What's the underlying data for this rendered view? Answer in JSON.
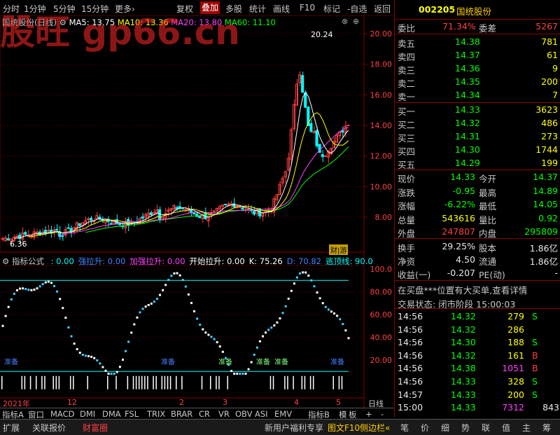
{
  "toolbar": {
    "items": [
      "分时",
      "1分钟",
      "5分钟",
      "15分钟",
      "更多›",
      "复权",
      "叠加",
      "多股",
      "统计",
      "画线",
      "F10",
      "标记",
      "-自选",
      "返回"
    ],
    "active_index": 6
  },
  "chart_header": {
    "stock_label": "国统股份(日线)",
    "ma5": "MA5: 13.75",
    "ma10": "MA10: 13.36",
    "ma20": "MA20: 13.80",
    "ma60": "MA60: 11.10",
    "peak_label": "20.24",
    "low_label": "6.36",
    "badge": "财|游"
  },
  "watermark": "股旺 gp66.cn",
  "price_axis": [
    "20.00",
    "18.00",
    "16.00",
    "14.00",
    "12.00",
    "10.00",
    "8.00"
  ],
  "indicator_header": {
    "name": "指标公式",
    "items": [
      {
        "text": ": 0.00",
        "color": "#00ffff"
      },
      {
        "text": "强拉升: 0.00",
        "color": "#4080ff"
      },
      {
        "text": "加强拉升: 0.00",
        "color": "#ff40ff"
      },
      {
        "text": "开始拉升: 0.00",
        "color": "#ffffff"
      },
      {
        "text": "K: 75.26",
        "color": "#ffffff"
      },
      {
        "text": "D: 70.82",
        "color": "#4080ff"
      },
      {
        "text": "逃顶线: 90.0",
        "color": "#00ffff"
      }
    ]
  },
  "indicator_axis": [
    "100.0",
    "80.00",
    "60.00",
    "40.00",
    "20.00"
  ],
  "indicator_labels": [
    "准备",
    "准备",
    "准备",
    "准备",
    "准备",
    "准备"
  ],
  "time_axis": [
    "2021年",
    "12",
    "2",
    "3",
    "4",
    "5"
  ],
  "time_axis_right": "日线",
  "tabs": [
    "指标A",
    "窗口",
    "MACD",
    "DMI",
    "DMA",
    "FSL",
    "TRIX",
    "BRAR",
    "CR",
    "VR",
    "OBV",
    "ASI",
    "EMV",
    "指标B",
    "模",
    "板",
    "+",
    "-"
  ],
  "status": {
    "left": [
      "扩展",
      "关联报价",
      "财富圈"
    ],
    "right": [
      "新用户福利专享",
      "图文F10",
      "侧边栏«",
      "笔",
      "价",
      "细",
      "势",
      "联",
      "值",
      "主",
      "筹"
    ]
  },
  "quote": {
    "code": "002205",
    "name": "国统股份",
    "weibi_label": "委比",
    "weibi": "71.34%",
    "weicha_label": "委差",
    "weicha": "5267",
    "asks": [
      {
        "label": "卖五",
        "price": "14.38",
        "vol": "781"
      },
      {
        "label": "卖四",
        "price": "14.37",
        "vol": "61"
      },
      {
        "label": "卖三",
        "price": "14.36",
        "vol": "9"
      },
      {
        "label": "卖二",
        "price": "14.35",
        "vol": "200"
      },
      {
        "label": "卖一",
        "price": "14.34",
        "vol": "7"
      }
    ],
    "bids": [
      {
        "label": "买一",
        "price": "14.33",
        "vol": "3623"
      },
      {
        "label": "买二",
        "price": "14.32",
        "vol": "486"
      },
      {
        "label": "买三",
        "price": "14.31",
        "vol": "273"
      },
      {
        "label": "买四",
        "price": "14.30",
        "vol": "1744"
      },
      {
        "label": "买五",
        "price": "14.29",
        "vol": "199"
      }
    ],
    "stats": [
      {
        "l1": "现价",
        "v1": "14.33",
        "c1": "grn",
        "l2": "今开",
        "v2": "14.37",
        "c2": "grn"
      },
      {
        "l1": "涨跌",
        "v1": "-0.95",
        "c1": "grn",
        "l2": "最高",
        "v2": "14.89",
        "c2": "grn"
      },
      {
        "l1": "涨幅",
        "v1": "-6.22%",
        "c1": "grn",
        "l2": "最低",
        "v2": "14.05",
        "c2": "grn"
      },
      {
        "l1": "总量",
        "v1": "543616",
        "c1": "yel",
        "l2": "量比",
        "v2": "0.92",
        "c2": "grn"
      },
      {
        "l1": "外盘",
        "v1": "247807",
        "c1": "red",
        "l2": "内盘",
        "v2": "295809",
        "c2": "grn"
      }
    ],
    "stats2": [
      {
        "l1": "换手",
        "v1": "29.25%",
        "l2": "股本",
        "v2": "1.86亿"
      },
      {
        "l1": "净资",
        "v1": "4.50",
        "l2": "流通",
        "v2": "1.86亿"
      },
      {
        "l1": "收益(一)",
        "v1": "-0.207",
        "l2": "PE(动)",
        "v2": "-"
      }
    ],
    "notice": "在买盘***位置有大买单,查看详情",
    "trade_state": "交易状态: 闭市阶段 15:00:03",
    "ticks": [
      {
        "t": "14:56",
        "p": "14.32",
        "v": "279",
        "s": "S",
        "vc": "yel"
      },
      {
        "t": "14:56",
        "p": "14.32",
        "v": "286",
        "s": "",
        "vc": "yel"
      },
      {
        "t": "14:56",
        "p": "14.30",
        "v": "188",
        "s": "S",
        "vc": "yel"
      },
      {
        "t": "14:56",
        "p": "14.32",
        "v": "161",
        "s": "B",
        "vc": "yel"
      },
      {
        "t": "14:56",
        "p": "14.38",
        "v": "1051",
        "s": "B",
        "vc": "mag"
      },
      {
        "t": "14:56",
        "p": "14.33",
        "v": "328",
        "s": "S",
        "vc": "yel"
      },
      {
        "t": "14:57",
        "p": "14.33",
        "v": "200",
        "s": "S",
        "vc": "yel"
      },
      {
        "t": "15:00",
        "p": "14.33",
        "v": "7312",
        "s": "",
        "vc": "mag"
      }
    ],
    "last_tick_extra": "843"
  },
  "colors": {
    "up": "#ff4040",
    "down": "#00ffff",
    "ma5": "#ffffff",
    "ma10": "#ffff00",
    "ma20": "#ff40ff",
    "ma60": "#00ff00",
    "grid": "#800000"
  }
}
